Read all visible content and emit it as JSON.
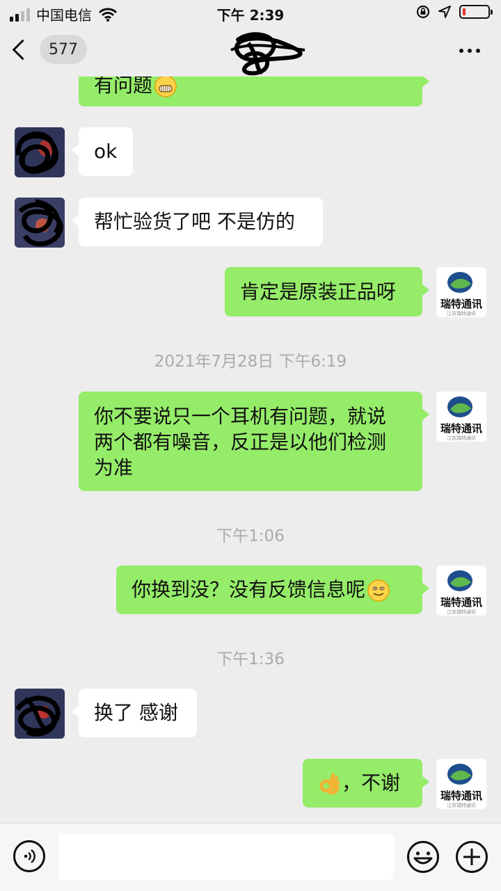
{
  "status_bar": {
    "carrier": "中国电信",
    "time": "下午 2:39",
    "battery_level": 0.12
  },
  "nav": {
    "unread_count": "577"
  },
  "messages": [
    {
      "side": "right",
      "text": "有问题"
    },
    {
      "side": "left",
      "text": "ok"
    },
    {
      "side": "left",
      "text": "帮忙验货了吧 不是仿的"
    },
    {
      "side": "right",
      "text": "肯定是原装正品呀"
    },
    {
      "timestamp": "2021年7月28日 下午6:19"
    },
    {
      "side": "right",
      "lines": [
        "你不要说只一个耳机有问题，就说",
        "两个都有噪音，反正是以他们检测",
        "为准"
      ]
    },
    {
      "timestamp": "下午1:06"
    },
    {
      "side": "right",
      "text": "你换到没？没有反馈信息呢"
    },
    {
      "timestamp": "下午1:36"
    },
    {
      "side": "left",
      "text": "换了 感谢"
    },
    {
      "side": "right",
      "text": "，不谢"
    }
  ],
  "shop_avatar": {
    "name": "瑞特通讯",
    "tagline": "江苏瑞特通讯"
  },
  "colors": {
    "background": "#ededed",
    "sent_bubble": "#95ec69",
    "received_bubble": "#ffffff",
    "timestamp": "#aaaaaa"
  },
  "icons": [
    "voice-icon",
    "emoji-icon",
    "plus-icon",
    "more-icon",
    "back-icon"
  ]
}
